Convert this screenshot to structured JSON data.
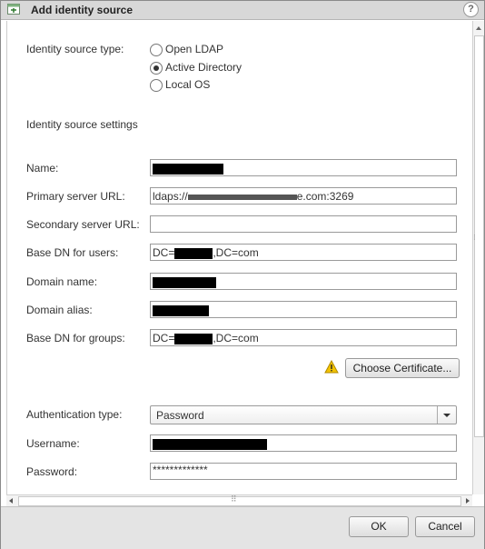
{
  "title": "Add identity source",
  "help": "?",
  "source_type": {
    "label": "Identity source type:",
    "options": [
      {
        "label": "Open LDAP",
        "selected": false
      },
      {
        "label": "Active Directory",
        "selected": true
      },
      {
        "label": "Local OS",
        "selected": false
      }
    ]
  },
  "settings_heading": "Identity source settings",
  "fields": {
    "name": {
      "label": "Name:"
    },
    "primary_url": {
      "label": "Primary server URL:",
      "prefix": "ldaps://",
      "suffix": "e.com:3269"
    },
    "secondary_url": {
      "label": "Secondary server URL:"
    },
    "base_dn_users": {
      "label": "Base DN for users:",
      "prefix": "DC=",
      "suffix": ",DC=com"
    },
    "domain_name": {
      "label": "Domain name:"
    },
    "domain_alias": {
      "label": "Domain alias:"
    },
    "base_dn_groups": {
      "label": "Base DN for groups:",
      "prefix": "DC=",
      "suffix": ",DC=com"
    }
  },
  "choose_certificate": "Choose Certificate...",
  "auth": {
    "label": "Authentication type:",
    "value": "Password"
  },
  "username": {
    "label": "Username:"
  },
  "password": {
    "label": "Password:",
    "value": "*************"
  },
  "buttons": {
    "ok": "OK",
    "cancel": "Cancel"
  },
  "colors": {
    "warning": "#f2c200",
    "titlebar": "#d8d8d8",
    "footer": "#e4e4e4"
  }
}
